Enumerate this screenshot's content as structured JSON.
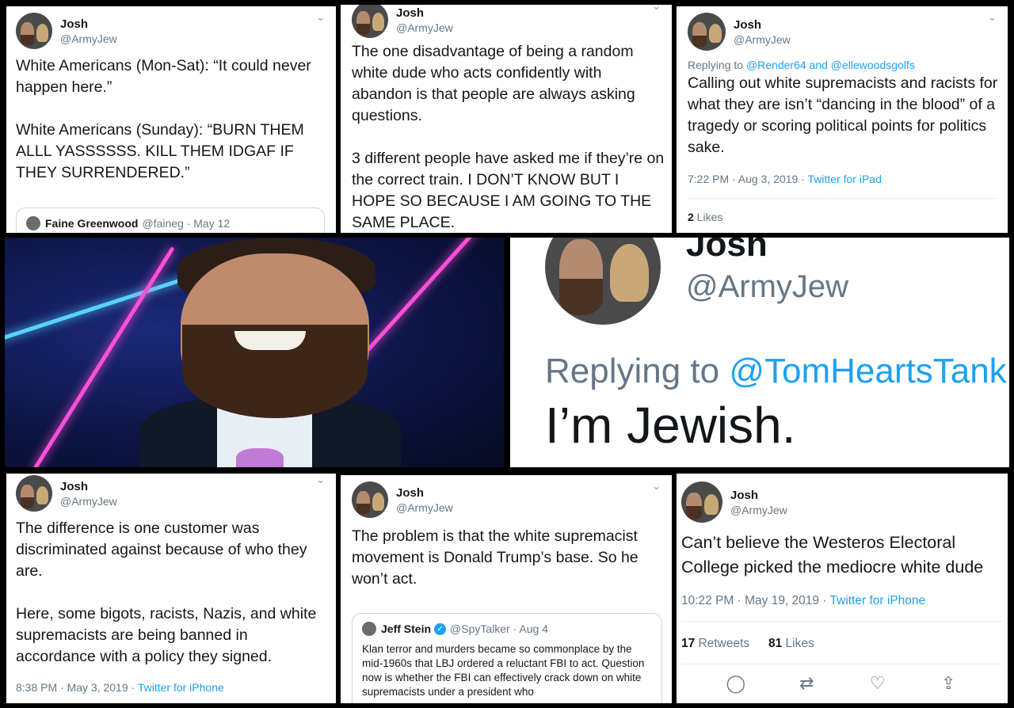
{
  "tweets": [
    {
      "name": "Josh",
      "handle": "@ArmyJew",
      "text": "White Americans (Mon-Sat): “It could never happen here.”\n\nWhite Americans (Sunday): “BURN THEM ALLL YASSSSSS. KILL THEM IDGAF IF THEY SURRENDERED.”",
      "quote": {
        "name": "Faine Greenwood",
        "handle": "@faineg · May 12"
      }
    },
    {
      "name": "Josh",
      "handle": "@ArmyJew",
      "text": "The one disadvantage of being a random white dude who acts confidently with abandon is that people are always asking questions.\n\n3 different people have asked me if they’re on the correct train. I DON’T KNOW BUT I HOPE SO BECAUSE I AM GOING TO THE SAME PLACE."
    },
    {
      "name": "Josh",
      "handle": "@ArmyJew",
      "replying_prefix": "Replying to ",
      "replying_to": "@Render64 and @ellewoodsgolfs",
      "text": "Calling out white supremacists and racists for what they are isn’t “dancing in the blood” of a tragedy or scoring political points for politics sake.",
      "timestamp": "7:22 PM · Aug 3, 2019 · ",
      "source": "Twitter for iPad",
      "likes_count": "2",
      "likes_label": " Likes"
    },
    {
      "name": "Josh",
      "handle": "@ArmyJew",
      "replying_prefix": "Replying to ",
      "replying_to": "@TomHeartsTank",
      "text": "I’m Jewish."
    },
    {
      "name": "Josh",
      "handle": "@ArmyJew",
      "text": "The difference is one customer was discriminated against because of who they are.\n\nHere, some bigots, racists, Nazis, and white supremacists are being banned in accordance with a policy they signed.",
      "timestamp": "8:38 PM · May 3, 2019 · ",
      "source": "Twitter for iPhone"
    },
    {
      "name": "Josh",
      "handle": "@ArmyJew",
      "text": "The problem is that the white supremacist movement is Donald Trump’s base. So he won’t act.",
      "quote": {
        "name": "Jeff Stein",
        "handle": "@SpyTalker · Aug 4",
        "text": "Klan terror and murders became so commonplace by the mid-1960s that LBJ ordered a reluctant FBI to act. Question now is whether the FBI can effectively crack down on white supremacists under a president who"
      }
    },
    {
      "name": "Josh",
      "handle": "@ArmyJew",
      "text": "Can’t believe the Westeros Electoral College picked the mediocre white dude",
      "timestamp": "10:22 PM · May 19, 2019 · ",
      "source": "Twitter for iPhone",
      "retweets_count": "17",
      "retweets_label": " Retweets",
      "likes_count": "81",
      "likes_label": " Likes"
    }
  ],
  "icons": {
    "caret": "⌄",
    "reply": "◯",
    "retweet": "⇄",
    "like": "♡",
    "share": "⇪",
    "verified": "✓"
  },
  "colors": {
    "link_blue": "#1da1f2",
    "muted_gray": "#657786",
    "text_dark": "#14171a"
  }
}
